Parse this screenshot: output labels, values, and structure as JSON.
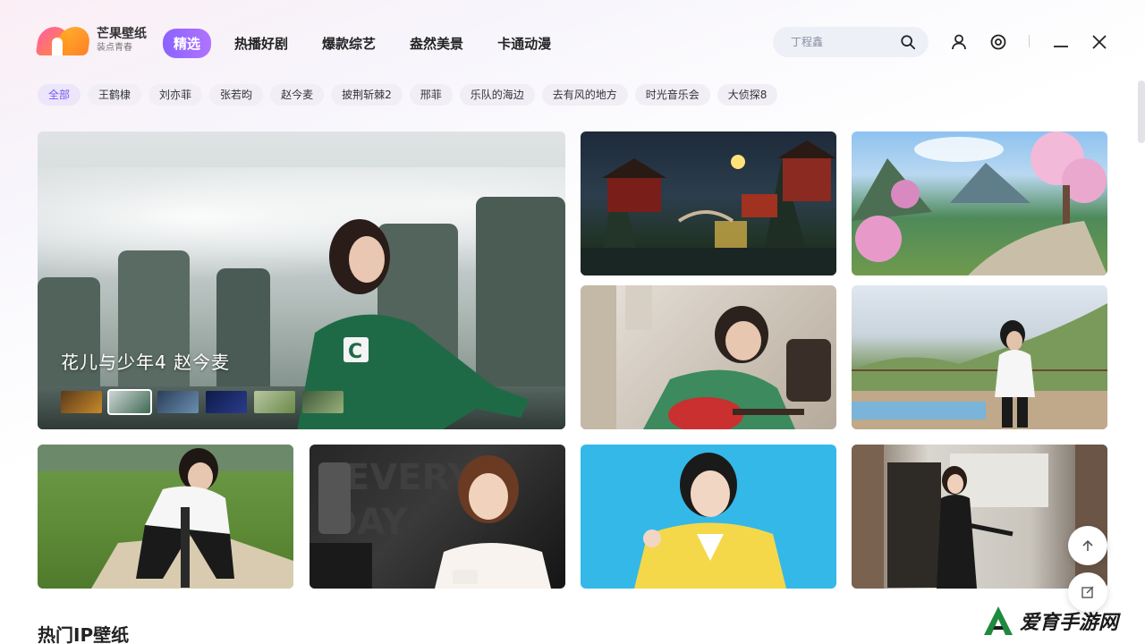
{
  "app": {
    "name": "芒果壁纸",
    "slogan": "装点青春"
  },
  "nav": {
    "tabs": [
      "精选",
      "热播好剧",
      "爆款综艺",
      "盎然美景",
      "卡通动漫"
    ]
  },
  "search": {
    "placeholder": "丁程鑫"
  },
  "chips": [
    "全部",
    "王鹤棣",
    "刘亦菲",
    "张若昀",
    "赵今麦",
    "披荆斩棘2",
    "邢菲",
    "乐队的海边",
    "去有风的地方",
    "时光音乐会",
    "大侦探8"
  ],
  "hero": {
    "title": "花儿与少年4  赵今麦"
  },
  "section": {
    "title": "热门IP壁纸"
  },
  "watermark": {
    "text": "爱育手游网"
  },
  "colors": {
    "accent": "#8a63ff",
    "chip_bg": "#f1eef6"
  },
  "icons": {
    "search": "search-icon",
    "user": "user-icon",
    "settings": "settings-icon",
    "minimize": "minimize-icon",
    "close": "close-icon",
    "back_to_top": "arrow-up-icon",
    "feedback": "edit-icon"
  }
}
